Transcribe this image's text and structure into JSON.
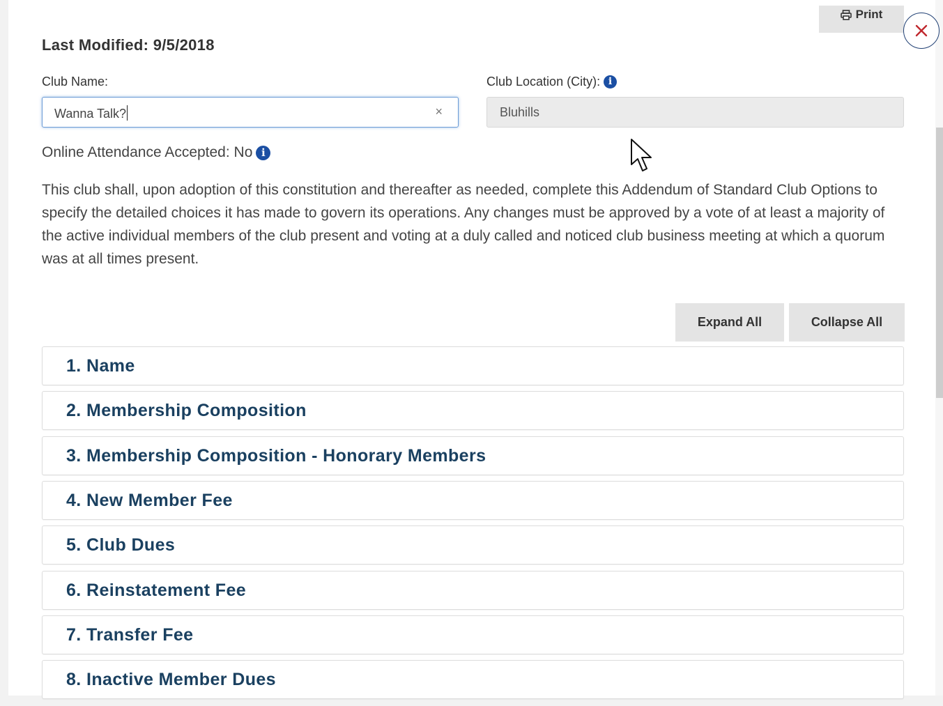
{
  "header": {
    "print_label": "Print",
    "last_modified": "Last Modified: 9/5/2018"
  },
  "form": {
    "club_name_label": "Club Name:",
    "club_name_value": "Wanna Talk?",
    "club_name_clear": "×",
    "club_location_label": "Club Location (City):",
    "club_location_value": "Bluhills",
    "online_attendance": "Online Attendance Accepted: No"
  },
  "description": "This club shall, upon adoption of this constitution and thereafter as needed, complete this Addendum of Standard Club Options to specify the detailed choices it has made to govern its operations. Any changes must be approved by a vote of at least a majority of the active individual members of the club present and voting at a duly called and noticed club business meeting at which a quorum was at all times present.",
  "actions": {
    "expand_all": "Expand All",
    "collapse_all": "Collapse All"
  },
  "sections": [
    "1. Name",
    "2. Membership Composition",
    "3. Membership Composition - Honorary Members",
    "4. New Member Fee",
    "5. Club Dues",
    "6. Reinstatement Fee",
    "7. Transfer Fee",
    "8. Inactive Member Dues"
  ],
  "icons": {
    "print": "printer-icon",
    "close": "close-icon",
    "info": "info-icon",
    "clear": "clear-icon",
    "cursor": "mouse-pointer-icon"
  },
  "colors": {
    "heading_text": "#1a4060",
    "close_x": "#c0282e",
    "info_blue": "#1b4fa3",
    "button_gray": "#e4e4e4",
    "focus_border": "#6b9bd6"
  }
}
